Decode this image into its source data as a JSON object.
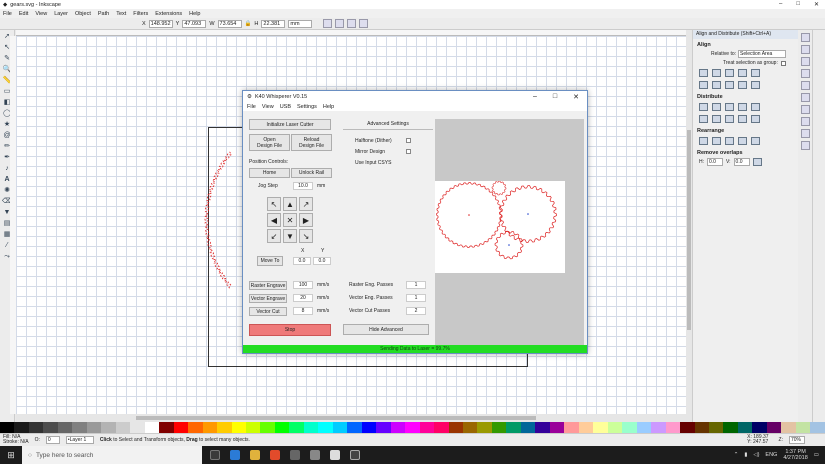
{
  "window": {
    "title": "gears.svg - Inkscape"
  },
  "menu": [
    "File",
    "Edit",
    "View",
    "Layer",
    "Object",
    "Path",
    "Text",
    "Filters",
    "Extensions",
    "Help"
  ],
  "toolctrl": {
    "x_label": "X",
    "x": "148.952",
    "y_label": "Y",
    "y": "47.093",
    "w_label": "W",
    "w": "73.654",
    "h_label": "H",
    "h": "22.381",
    "unit": "mm"
  },
  "dock": {
    "title": "Align and Distribute (Shift+Ctrl+A)",
    "align_heading": "Align",
    "relative_label": "Relative to:",
    "relative_value": "Selection Area",
    "treat_group": "Treat selection as group:",
    "distribute_heading": "Distribute",
    "rearrange_heading": "Rearrange",
    "remove_overlaps_heading": "Remove overlaps",
    "h_label": "H:",
    "h_value": "0.0",
    "v_label": "V:",
    "v_value": "0.0"
  },
  "k40": {
    "title": "K40 Whisperer V0.15",
    "menu": [
      "File",
      "View",
      "USB",
      "Settings",
      "Help"
    ],
    "init_label": "Initialize Laser Cutter",
    "open_label": "Open\nDesign File",
    "reload_label": "Reload\nDesign File",
    "position_controls": "Position Controls:",
    "home_label": "Home",
    "unlock_label": "Unlock Rail",
    "jog_step_label": "Jog Step",
    "jog_step_value": "10.0",
    "jog_unit": "mm",
    "move_to_label": "Move To",
    "x_axis": "X",
    "y_axis": "Y",
    "move_x": "0.0",
    "move_y": "0.0",
    "raster_engrave": "Raster Engrave",
    "raster_speed": "100",
    "vector_engrave": "Vector Engrave",
    "vector_speed": "20",
    "vector_cut": "Vector Cut",
    "cut_speed": "8",
    "speed_unit": "mm/s",
    "stop_label": "Stop",
    "advanced_settings": "Advanced Settings",
    "halftone": "Halftone (Dither)",
    "mirror": "Mirror Design",
    "input_csys": "Use Input CSYS",
    "raster_passes_label": "Raster Eng. Passes",
    "raster_passes": "1",
    "vector_passes_label": "Vector Eng. Passes",
    "vector_passes": "1",
    "cut_passes_label": "Vector Cut Passes",
    "cut_passes": "2",
    "hide_advanced": "Hide Advanced",
    "status": "Sending Data to Laser = 99.7%"
  },
  "status": {
    "fill_label": "Fill:",
    "fill_value": "N/A",
    "stroke_label": "Stroke:",
    "stroke_value": "N/A",
    "o_label": "O:",
    "o_value": "0",
    "layer": "•Layer 1",
    "message_b1": "Click",
    "message_t1": " to Select and Transform objects, ",
    "message_b2": "Drag",
    "message_t2": " to select many objects.",
    "x_coord": "X: 189.37",
    "y_coord": "Y: 247.57",
    "zoom_label": "Z:",
    "zoom": "70%"
  },
  "taskbar": {
    "search_placeholder": "Type here to search",
    "lang": "ENG",
    "time": "1:37 PM",
    "date": "4/27/2018"
  },
  "colors": {
    "accent": "#6a8fc2",
    "progress": "#22dd22",
    "stop": "#ef7a7a",
    "gear": "#dd2222"
  },
  "palette": [
    "#000000",
    "#1a1a1a",
    "#333333",
    "#4d4d4d",
    "#666666",
    "#808080",
    "#999999",
    "#b3b3b3",
    "#cccccc",
    "#e6e6e6",
    "#ffffff",
    "#800000",
    "#ff0000",
    "#ff6600",
    "#ff9900",
    "#ffcc00",
    "#ffff00",
    "#ccff00",
    "#66ff00",
    "#00ff00",
    "#00ff66",
    "#00ffcc",
    "#00ffff",
    "#00ccff",
    "#0066ff",
    "#0000ff",
    "#6600ff",
    "#cc00ff",
    "#ff00ff",
    "#ff0099",
    "#ff0066",
    "#993300",
    "#996600",
    "#999900",
    "#339900",
    "#009966",
    "#006699",
    "#330099",
    "#990099",
    "#ff9999",
    "#ffcc99",
    "#ffff99",
    "#ccff99",
    "#99ffcc",
    "#99ccff",
    "#cc99ff",
    "#ff99cc",
    "#660000",
    "#663300",
    "#666600",
    "#006600",
    "#006666",
    "#000066",
    "#660066",
    "#e3c3a3",
    "#c3e3a3",
    "#a3c3e3"
  ]
}
